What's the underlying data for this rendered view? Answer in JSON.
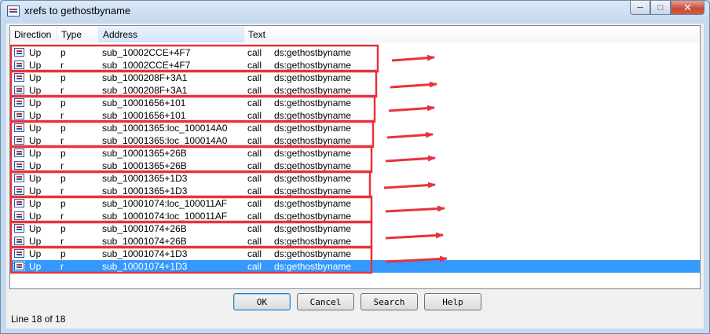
{
  "window": {
    "title": "xrefs to gethostbyname"
  },
  "columns": [
    "Direction",
    "Type",
    "Address",
    "Text"
  ],
  "rows": [
    {
      "dir": "Up",
      "type": "p",
      "address": "sub_10002CCE+4F7",
      "op": "call",
      "target": "ds:gethostbyname"
    },
    {
      "dir": "Up",
      "type": "r",
      "address": "sub_10002CCE+4F7",
      "op": "call",
      "target": "ds:gethostbyname"
    },
    {
      "dir": "Up",
      "type": "p",
      "address": "sub_1000208F+3A1",
      "op": "call",
      "target": "ds:gethostbyname"
    },
    {
      "dir": "Up",
      "type": "r",
      "address": "sub_1000208F+3A1",
      "op": "call",
      "target": "ds:gethostbyname"
    },
    {
      "dir": "Up",
      "type": "p",
      "address": "sub_10001656+101",
      "op": "call",
      "target": "ds:gethostbyname"
    },
    {
      "dir": "Up",
      "type": "r",
      "address": "sub_10001656+101",
      "op": "call",
      "target": "ds:gethostbyname"
    },
    {
      "dir": "Up",
      "type": "p",
      "address": "sub_10001365:loc_100014A0",
      "op": "call",
      "target": "ds:gethostbyname"
    },
    {
      "dir": "Up",
      "type": "r",
      "address": "sub_10001365:loc_100014A0",
      "op": "call",
      "target": "ds:gethostbyname"
    },
    {
      "dir": "Up",
      "type": "p",
      "address": "sub_10001365+26B",
      "op": "call",
      "target": "ds:gethostbyname"
    },
    {
      "dir": "Up",
      "type": "r",
      "address": "sub_10001365+26B",
      "op": "call",
      "target": "ds:gethostbyname"
    },
    {
      "dir": "Up",
      "type": "p",
      "address": "sub_10001365+1D3",
      "op": "call",
      "target": "ds:gethostbyname"
    },
    {
      "dir": "Up",
      "type": "r",
      "address": "sub_10001365+1D3",
      "op": "call",
      "target": "ds:gethostbyname"
    },
    {
      "dir": "Up",
      "type": "p",
      "address": "sub_10001074:loc_100011AF",
      "op": "call",
      "target": "ds:gethostbyname"
    },
    {
      "dir": "Up",
      "type": "r",
      "address": "sub_10001074:loc_100011AF",
      "op": "call",
      "target": "ds:gethostbyname"
    },
    {
      "dir": "Up",
      "type": "p",
      "address": "sub_10001074+26B",
      "op": "call",
      "target": "ds:gethostbyname"
    },
    {
      "dir": "Up",
      "type": "r",
      "address": "sub_10001074+26B",
      "op": "call",
      "target": "ds:gethostbyname"
    },
    {
      "dir": "Up",
      "type": "p",
      "address": "sub_10001074+1D3",
      "op": "call",
      "target": "ds:gethostbyname"
    },
    {
      "dir": "Up",
      "type": "r",
      "address": "sub_10001074+1D3",
      "op": "call",
      "target": "ds:gethostbyname",
      "selected": true
    }
  ],
  "buttons": {
    "ok": "OK",
    "cancel": "Cancel",
    "search": "Search",
    "help": "Help"
  },
  "status": "Line 18 of 18",
  "icons": {
    "window": "xrefs-window-icon",
    "row": "xref-row-icon",
    "minimize": "minimize-icon",
    "maximize": "maximize-icon",
    "close": "close-icon"
  },
  "colors": {
    "selection": "#3399ff",
    "annotation": "#e8333c"
  }
}
